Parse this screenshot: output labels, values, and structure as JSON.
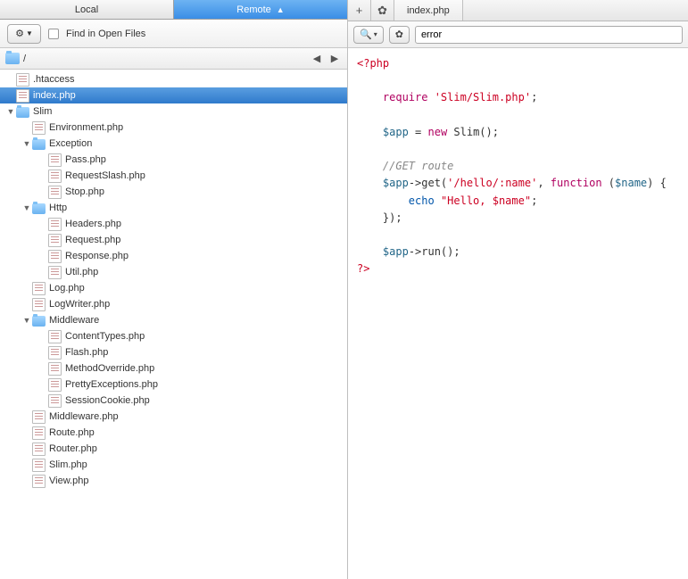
{
  "sidebar": {
    "tabs": {
      "local": "Local",
      "remote": "Remote"
    },
    "toolbar": {
      "find_label": "Find in Open Files"
    },
    "path": "/",
    "tree": [
      {
        "depth": 0,
        "type": "file",
        "twisty": "",
        "label": ".htaccess",
        "selected": false
      },
      {
        "depth": 0,
        "type": "file",
        "twisty": "",
        "label": "index.php",
        "selected": true
      },
      {
        "depth": 0,
        "type": "folder",
        "twisty": "▼",
        "label": "Slim",
        "selected": false
      },
      {
        "depth": 1,
        "type": "file",
        "twisty": "",
        "label": "Environment.php",
        "selected": false
      },
      {
        "depth": 1,
        "type": "folder",
        "twisty": "▼",
        "label": "Exception",
        "selected": false
      },
      {
        "depth": 2,
        "type": "file",
        "twisty": "",
        "label": "Pass.php",
        "selected": false
      },
      {
        "depth": 2,
        "type": "file",
        "twisty": "",
        "label": "RequestSlash.php",
        "selected": false
      },
      {
        "depth": 2,
        "type": "file",
        "twisty": "",
        "label": "Stop.php",
        "selected": false
      },
      {
        "depth": 1,
        "type": "folder",
        "twisty": "▼",
        "label": "Http",
        "selected": false
      },
      {
        "depth": 2,
        "type": "file",
        "twisty": "",
        "label": "Headers.php",
        "selected": false
      },
      {
        "depth": 2,
        "type": "file",
        "twisty": "",
        "label": "Request.php",
        "selected": false
      },
      {
        "depth": 2,
        "type": "file",
        "twisty": "",
        "label": "Response.php",
        "selected": false
      },
      {
        "depth": 2,
        "type": "file",
        "twisty": "",
        "label": "Util.php",
        "selected": false
      },
      {
        "depth": 1,
        "type": "file",
        "twisty": "",
        "label": "Log.php",
        "selected": false
      },
      {
        "depth": 1,
        "type": "file",
        "twisty": "",
        "label": "LogWriter.php",
        "selected": false
      },
      {
        "depth": 1,
        "type": "folder",
        "twisty": "▼",
        "label": "Middleware",
        "selected": false
      },
      {
        "depth": 2,
        "type": "file",
        "twisty": "",
        "label": "ContentTypes.php",
        "selected": false
      },
      {
        "depth": 2,
        "type": "file",
        "twisty": "",
        "label": "Flash.php",
        "selected": false
      },
      {
        "depth": 2,
        "type": "file",
        "twisty": "",
        "label": "MethodOverride.php",
        "selected": false
      },
      {
        "depth": 2,
        "type": "file",
        "twisty": "",
        "label": "PrettyExceptions.php",
        "selected": false
      },
      {
        "depth": 2,
        "type": "file",
        "twisty": "",
        "label": "SessionCookie.php",
        "selected": false
      },
      {
        "depth": 1,
        "type": "file",
        "twisty": "",
        "label": "Middleware.php",
        "selected": false
      },
      {
        "depth": 1,
        "type": "file",
        "twisty": "",
        "label": "Route.php",
        "selected": false
      },
      {
        "depth": 1,
        "type": "file",
        "twisty": "",
        "label": "Router.php",
        "selected": false
      },
      {
        "depth": 1,
        "type": "file",
        "twisty": "",
        "label": "Slim.php",
        "selected": false
      },
      {
        "depth": 1,
        "type": "file",
        "twisty": "",
        "label": "View.php",
        "selected": false
      }
    ]
  },
  "editor": {
    "tab_title": "index.php",
    "search_value": "error",
    "code": {
      "open": "<?php",
      "l1a": "require ",
      "l1b": "'Slim/Slim.php'",
      "l1c": ";",
      "l2a": "$app",
      "l2b": " = ",
      "l2c": "new",
      "l2d": " Slim();",
      "c1": "//GET route",
      "l3a": "$app",
      "l3b": "->get(",
      "l3c": "'/hello/:name'",
      "l3d": ", ",
      "l3e": "function",
      "l3f": " (",
      "l3g": "$name",
      "l3h": ") {",
      "l4a": "echo",
      "l4b": " ",
      "l4c": "\"Hello, $name\"",
      "l4d": ";",
      "l5": "});",
      "l6a": "$app",
      "l6b": "->run();",
      "close": "?>"
    }
  }
}
